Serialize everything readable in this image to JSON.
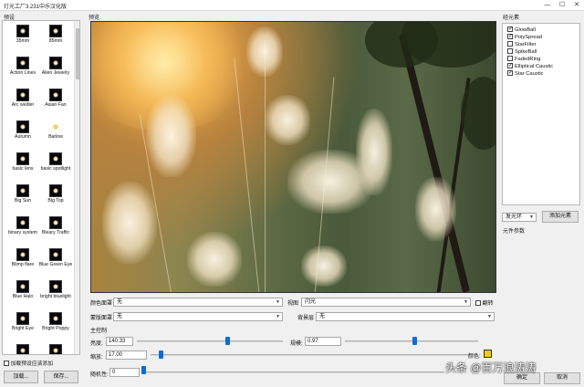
{
  "window": {
    "title": "灯光工厂3.231中乐汉化版",
    "minimize": "—",
    "maximize": "☐",
    "close": "✕"
  },
  "presets": {
    "section_label": "预设",
    "items": [
      {
        "label": "35mm"
      },
      {
        "label": "85mm"
      },
      {
        "label": "Action Lines"
      },
      {
        "label": "Alien Jewelry"
      },
      {
        "label": "Arc welder"
      },
      {
        "label": "Asian Fan"
      },
      {
        "label": "Autumn"
      },
      {
        "label": "Barlow"
      },
      {
        "label": "basic lens"
      },
      {
        "label": "basic spotlight"
      },
      {
        "label": "Big Sun"
      },
      {
        "label": "Big Top"
      },
      {
        "label": "binary system"
      },
      {
        "label": "Bleary Traffic"
      },
      {
        "label": "Blimp flare"
      },
      {
        "label": "Blue Green Eye"
      },
      {
        "label": "Blue Halo"
      },
      {
        "label": "bright bluelight"
      },
      {
        "label": "Bright Eye"
      },
      {
        "label": "Bright Poppy"
      },
      {
        "label": ""
      },
      {
        "label": ""
      }
    ],
    "add_label": "加载预设应该添加",
    "load_button": "加载...",
    "save_button": "保存..."
  },
  "preview": {
    "section_label": "预览"
  },
  "controls": {
    "color_mask_label": "颜色面罩",
    "color_mask_value": "无",
    "view_label": "视图",
    "view_value": "闪光",
    "flare_label": "翻转",
    "texture_mask_label": "蒙版面罩",
    "texture_mask_value": "无",
    "background_label": "背景层",
    "background_value": "无",
    "main_control_label": "主控制",
    "brightness_label": "亮度:",
    "brightness_value": "140.33",
    "brightness_level": 0.62,
    "scale_label": "缩放:",
    "scale_value": "17.00",
    "scale_level": 0.03,
    "angle_label": "规模:",
    "angle_value": "0.97",
    "angle_level": 0.52,
    "random_label": "随机性:",
    "random_value": "0",
    "random_level": 0.0,
    "color_label": "颜色:",
    "color_swatch": "#f5c518"
  },
  "elements": {
    "section_label": "经元素",
    "items": [
      {
        "label": "GlowBall",
        "checked": true
      },
      {
        "label": "PolySpread",
        "checked": true
      },
      {
        "label": "StarFilter",
        "checked": false
      },
      {
        "label": "SpikeBall",
        "checked": false
      },
      {
        "label": "FadedRing",
        "checked": false
      },
      {
        "label": "Elliptical Caustic",
        "checked": true
      },
      {
        "label": "Star Caustic",
        "checked": true
      }
    ],
    "light_type_value": "发光环",
    "add_element_button": "添加元素",
    "element_params_label": "元件参数",
    "ok_button": "确定",
    "cancel_button": "取消"
  },
  "watermark": "头条 @百万浪涛涛"
}
